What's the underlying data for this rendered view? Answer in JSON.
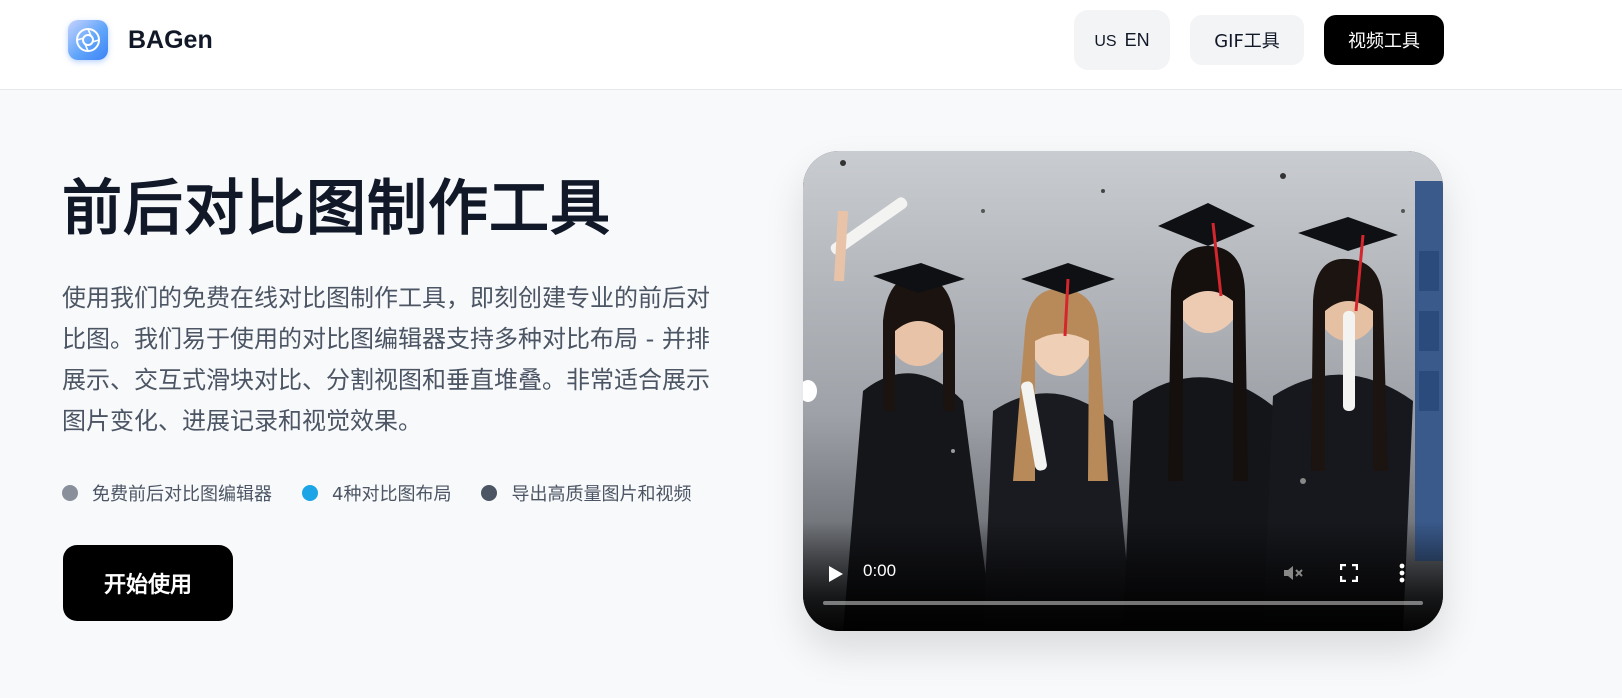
{
  "header": {
    "logo_text": "BAGen",
    "lang_flag": "US",
    "lang_label": "EN",
    "gif_tool_label": "GIF工具",
    "video_tool_label": "视频工具"
  },
  "hero": {
    "title": "前后对比图制作工具",
    "description": "使用我们的免费在线对比图制作工具，即刻创建专业的前后对比图。我们易于使用的对比图编辑器支持多种对比布局 - 并排展示、交互式滑块对比、分割视图和垂直堆叠。非常适合展示图片变化、进展记录和视觉效果。",
    "features": [
      {
        "label": "免费前后对比图编辑器",
        "dot_color": "#8a8f9c"
      },
      {
        "label": "4种对比图布局",
        "dot_color": "#1ba4e6"
      },
      {
        "label": "导出高质量图片和视频",
        "dot_color": "#4b5563"
      }
    ],
    "cta_label": "开始使用"
  },
  "video": {
    "time": "0:00",
    "progress": 0,
    "controls": [
      "play-icon",
      "mute-icon",
      "fullscreen-icon",
      "more-options-icon"
    ]
  },
  "colors": {
    "background": "#f8f9fb",
    "primary_button": "#000000",
    "secondary_button": "#f3f4f6",
    "accent_blue": "#1ba4e6"
  }
}
